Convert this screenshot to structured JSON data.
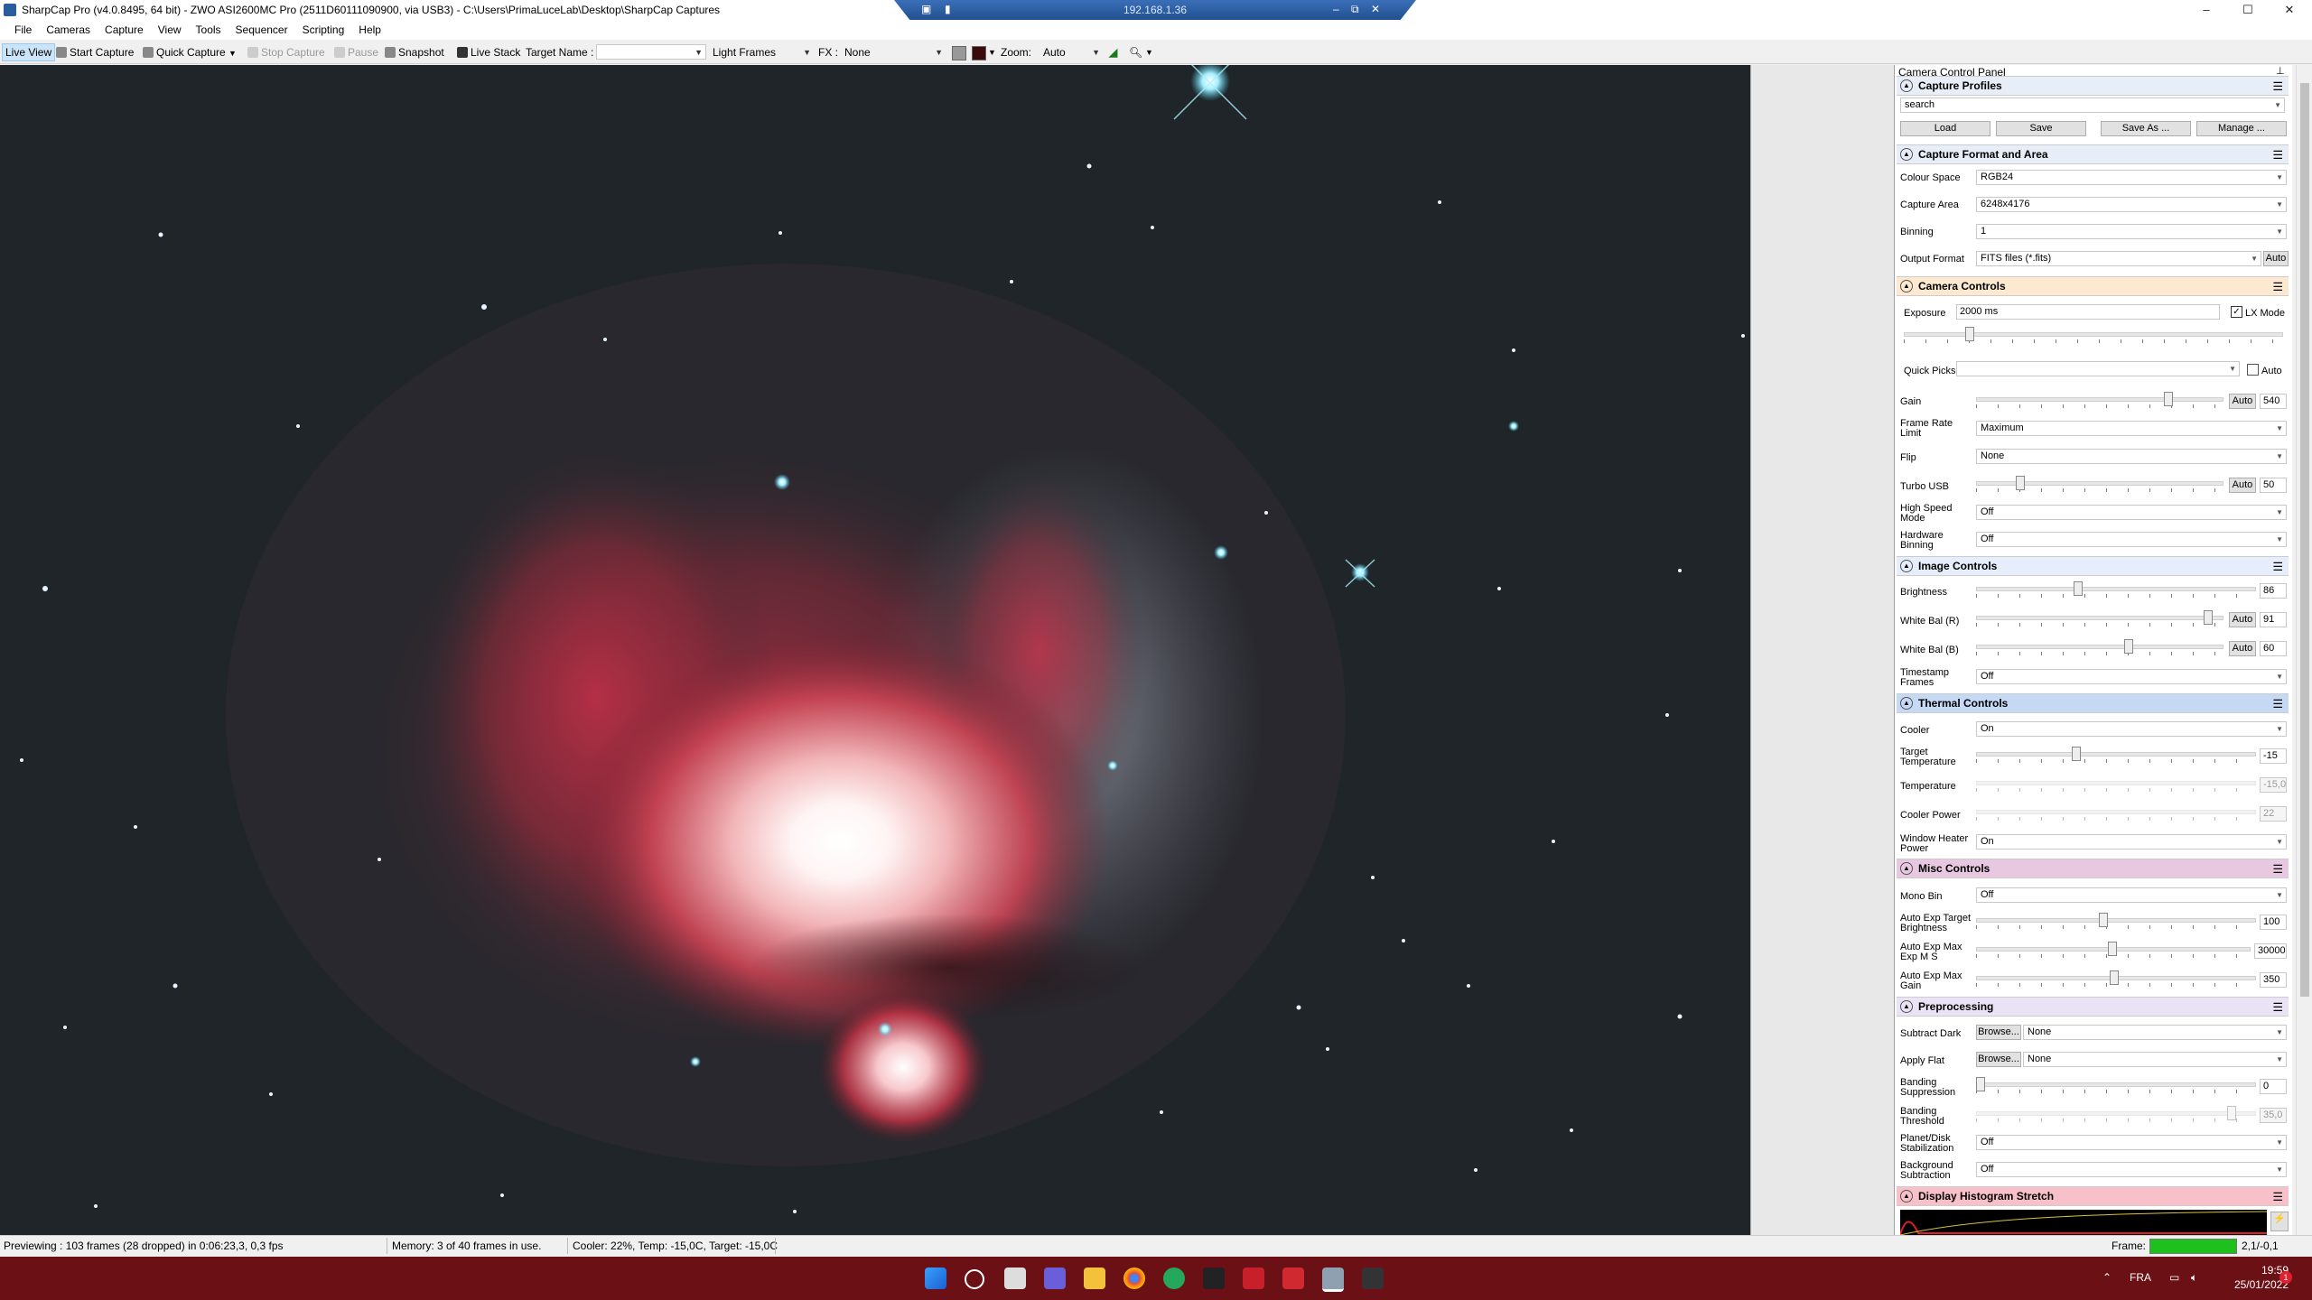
{
  "window": {
    "title": "SharpCap Pro (v4.0.8495, 64 bit) - ZWO ASI2600MC Pro (2511D60111090900, via USB3) - C:\\Users\\PrimaLuceLab\\Desktop\\SharpCap Captures",
    "remote_ip": "192.168.1.36"
  },
  "menu": [
    "File",
    "Cameras",
    "Capture",
    "View",
    "Tools",
    "Sequencer",
    "Scripting",
    "Help"
  ],
  "toolbar": {
    "live_view": "Live View",
    "start_capture": "Start Capture",
    "quick_capture": "Quick Capture",
    "stop_capture": "Stop Capture",
    "pause": "Pause",
    "snapshot": "Snapshot",
    "live_stack": "Live Stack",
    "target_name_label": "Target Name :",
    "target_name_value": "",
    "frame_type": "Light Frames",
    "fx_label": "FX :",
    "fx_value": "None",
    "zoom_label": "Zoom:",
    "zoom_value": "Auto"
  },
  "panel": {
    "title": "Camera Control Panel",
    "profiles": {
      "header": "Capture Profiles",
      "selected": "search",
      "buttons": [
        "Load",
        "Save",
        "Save As ...",
        "Manage ..."
      ]
    },
    "format": {
      "header": "Capture Format and Area",
      "colour_space_label": "Colour Space",
      "colour_space": "RGB24",
      "capture_area_label": "Capture Area",
      "capture_area": "6248x4176",
      "binning_label": "Binning",
      "binning": "1",
      "output_format_label": "Output Format",
      "output_format": "FITS files (*.fits)",
      "auto": "Auto"
    },
    "camera": {
      "header": "Camera Controls",
      "exposure_label": "Exposure",
      "exposure": "2000 ms",
      "lx_mode": "LX Mode",
      "quick_picks_label": "Quick Picks",
      "quick_picks": "",
      "auto": "Auto",
      "gain_label": "Gain",
      "gain": "540",
      "frame_rate_label_1": "Frame Rate",
      "frame_rate_label_2": "Limit",
      "frame_rate": "Maximum",
      "flip_label": "Flip",
      "flip": "None",
      "turbo_label": "Turbo USB",
      "turbo": "50",
      "hsm_label_1": "High Speed",
      "hsm_label_2": "Mode",
      "hsm": "Off",
      "hwb_label_1": "Hardware",
      "hwb_label_2": "Binning",
      "hwb": "Off"
    },
    "image": {
      "header": "Image Controls",
      "brightness_label": "Brightness",
      "brightness": "86",
      "wbr_label": "White Bal (R)",
      "wbr": "91",
      "wbb_label": "White Bal (B)",
      "wbb": "60",
      "ts_label_1": "Timestamp",
      "ts_label_2": "Frames",
      "ts": "Off"
    },
    "thermal": {
      "header": "Thermal Controls",
      "cooler_label": "Cooler",
      "cooler": "On",
      "target_label_1": "Target",
      "target_label_2": "Temperature",
      "target": "-15",
      "temp_label": "Temperature",
      "temp": "-15,0",
      "power_label": "Cooler Power",
      "power": "22",
      "heater_label_1": "Window Heater",
      "heater_label_2": "Power",
      "heater": "On"
    },
    "misc": {
      "header": "Misc Controls",
      "mono_label": "Mono Bin",
      "mono": "Off",
      "aetb_label_1": "Auto Exp Target",
      "aetb_label_2": "Brightness",
      "aetb": "100",
      "aeme_label_1": "Auto Exp Max",
      "aeme_label_2": "Exp M S",
      "aeme": "30000",
      "aemg_label_1": "Auto Exp Max",
      "aemg_label_2": "Gain",
      "aemg": "350"
    },
    "pre": {
      "header": "Preprocessing",
      "sd_label": "Subtract Dark",
      "browse": "Browse...",
      "sd": "None",
      "af_label": "Apply Flat",
      "af": "None",
      "bs_label_1": "Banding",
      "bs_label_2": "Suppression",
      "bs": "0",
      "bt_label_1": "Banding",
      "bt_label_2": "Threshold",
      "bt": "35,0",
      "pds_label_1": "Planet/Disk",
      "pds_label_2": "Stabilization",
      "pds": "Off",
      "bgs_label_1": "Background",
      "bgs_label_2": "Subtraction",
      "bgs": "Off"
    },
    "histogram": {
      "header": "Display Histogram Stretch"
    }
  },
  "status": {
    "preview": "Previewing : 103 frames (28 dropped) in 0:06:23,3, 0,3 fps",
    "memory": "Memory: 3 of 40 frames in use.",
    "cooler": "Cooler: 22%, Temp: -15,0C, Target: -15,0C",
    "frame_label": "Frame:",
    "frame_value": "2,1/-0,1"
  },
  "taskbar": {
    "lang": "FRA",
    "time": "19:59",
    "date": "25/01/2022"
  },
  "colors": {
    "profiles_hdr": "#e8eef7",
    "format_hdr": "#e8eef7",
    "camera_hdr": "#fde8d0",
    "image_hdr": "#e6eefb",
    "thermal_hdr": "#c5d9f5",
    "misc_hdr": "#e8c8e0",
    "pre_hdr": "#e9e3f5",
    "hist_hdr": "#f8c0c8",
    "taskbar": "#6b1015"
  }
}
